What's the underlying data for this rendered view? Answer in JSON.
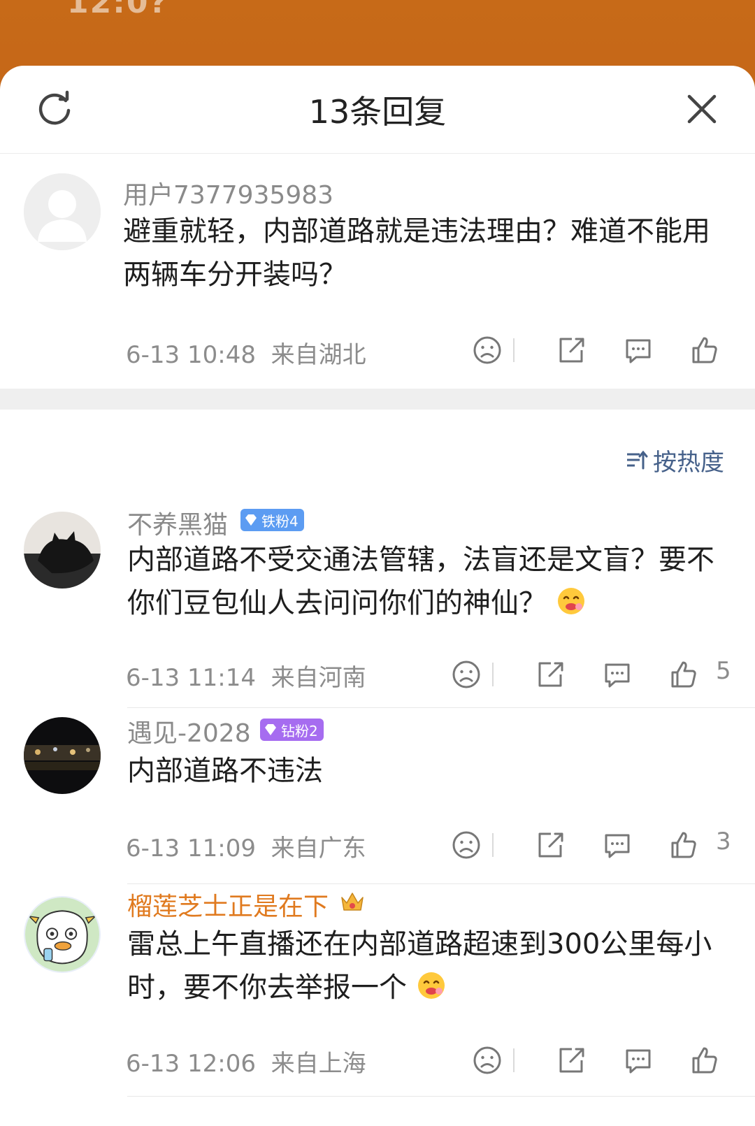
{
  "header": {
    "title": "13条回复"
  },
  "root_comment": {
    "username": "用户7377935983",
    "text": "避重就轻，内部道路就是违法理由？难道不能用两辆车分开装吗？",
    "time": "6-13 10:48",
    "location": "来自湖北"
  },
  "sort": {
    "label": "按热度"
  },
  "replies": [
    {
      "username": "不养黑猫",
      "badge": "铁粉4",
      "text": "内部道路不受交通法管辖，法盲还是文盲？要不你们豆包仙人去问问你们的神仙？",
      "time": "6-13 11:14",
      "location": "来自河南",
      "likes": "5"
    },
    {
      "username": "遇见-2028",
      "badge": "钻粉2",
      "text": "内部道路不违法",
      "time": "6-13 11:09",
      "location": "来自广东",
      "likes": "3"
    },
    {
      "username": "榴莲芝士正是在下",
      "text": "雷总上午直播还在内部道路超速到300公里每小时，要不你去举报一个",
      "time": "6-13 12:06",
      "location": "来自上海"
    }
  ],
  "colors": {
    "highlight_username": "#e07a1f",
    "badge_iron": "#5c9cf2",
    "badge_diamond": "#a66cf0",
    "sort_link": "#46618a"
  }
}
